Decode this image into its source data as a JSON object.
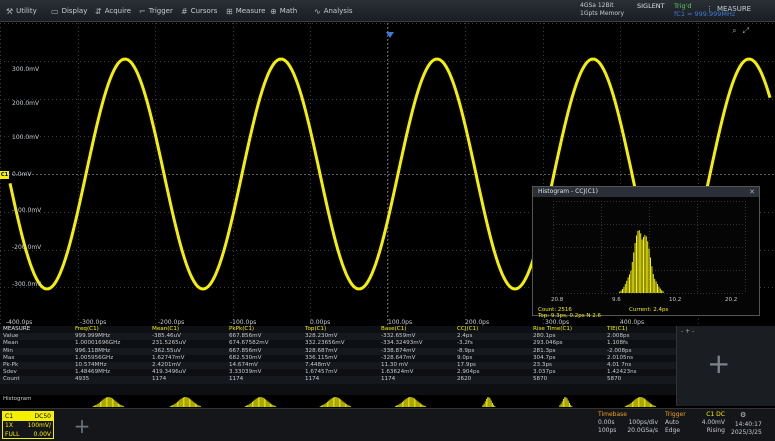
{
  "menu": {
    "items": [
      {
        "label": "Utility",
        "icon": "wrench-icon"
      },
      {
        "label": "Display",
        "icon": "display-icon"
      },
      {
        "label": "Acquire",
        "icon": "acquire-icon"
      },
      {
        "label": "Trigger",
        "icon": "trigger-icon"
      },
      {
        "label": "Cursors",
        "icon": "cursor-icon"
      },
      {
        "label": "Measure",
        "icon": "ruler-icon"
      },
      {
        "label": "Math",
        "icon": "math-icon"
      },
      {
        "label": "Analysis",
        "icon": "analysis-icon"
      }
    ],
    "status_line1": "4GSa 12Bit",
    "status_line2": "1Gpts Memory",
    "brand": "SIGLENT",
    "brand_sub": "Trig'd",
    "trig_freq": "fC1 = 999.999MHz",
    "measure_label": "MEASURE"
  },
  "waveform": {
    "y_labels": [
      "300.0mV",
      "200.0mV",
      "100.0mV",
      "0.0mV",
      "-100.0mV",
      "-200.0mV",
      "-300.0mV"
    ],
    "x_labels": [
      "-400.0ps",
      "-300.0ps",
      "-200.0ps",
      "-100.0ps",
      "0.00ps",
      "100.0ps",
      "200.0ps",
      "300.0ps",
      "400.0ps"
    ],
    "channel_marker": "C1",
    "trace_color": "#f4f000",
    "trigger_color": "#3a7bd5"
  },
  "histogram": {
    "title": "Histogram - CCJ(C1)",
    "x_ticks": [
      "20.8",
      "9.6",
      "10.2",
      "20.2"
    ],
    "count": "Count: 2516",
    "current": "Current: 2.4ps",
    "stats": "Top: 9.3ps, 0.2ps N 2.6"
  },
  "measure": {
    "label": "MEASURE",
    "headers": [
      "Freq(C1)",
      "Mean(C1)",
      "PkPk(C1)",
      "Top(C1)",
      "Base(C1)",
      "CCJ(C1)",
      "Rise Time(C1)",
      "TIE(C1)"
    ],
    "rows": [
      {
        "label": "Value",
        "cells": [
          "999.999MHz",
          "-385.46uV",
          "667.856mV",
          "328.230mV",
          "-332.659mV",
          "2.4ps",
          "280.1ps",
          "2.008ps"
        ]
      },
      {
        "label": "Mean",
        "cells": [
          "1.00001696GHz",
          "231.5265uV",
          "674.67582mV",
          "332.23656mV",
          "-334.32493mV",
          "-3.2fs",
          "293.046ps",
          "1.108fs"
        ]
      },
      {
        "label": "Min",
        "cells": [
          "996.118MHz",
          "-362.55uV",
          "667.856mV",
          "328.687mV",
          "-338.874mV",
          "-8.9ps",
          "281.3ps",
          "-2.008ps"
        ]
      },
      {
        "label": "Max",
        "cells": [
          "1.005956GHz",
          "1.62747mV",
          "682.530mV",
          "336.115mV",
          "-328.647mV",
          "9.0ps",
          "304.7ps",
          "2.0105ns"
        ]
      },
      {
        "label": "Pk-Pk",
        "cells": [
          "10.574MHz",
          "2.4201mV",
          "14.674mV",
          "7.448mV",
          "11.30 mV",
          "17.9ps",
          "23.3ps",
          "4.01 7ns"
        ]
      },
      {
        "label": "Sdev",
        "cells": [
          "1.48469MHz",
          "419.3496uV",
          "3.33039mV",
          "1.67457mV",
          "1.63624mV",
          "2.904ps",
          "3.037ps",
          "1.42423ns"
        ]
      },
      {
        "label": "Count",
        "cells": [
          "4935",
          "1174",
          "1174",
          "1174",
          "1174",
          "2620",
          "5870",
          "5870"
        ]
      }
    ],
    "histogram_label": "Histogram",
    "side_dots": "- + -"
  },
  "bottom": {
    "ch1": {
      "name": "C1",
      "coupling": "DC50",
      "scale": "100mV/",
      "bw": "FULL",
      "offset": "0.00V",
      "probe": "1X"
    },
    "timebase": {
      "header": "Timebase",
      "l1a": "0.00s",
      "l1b": "100ps/div",
      "l2a": "100ps",
      "l2b": "20.0GSa/s"
    },
    "trigger": {
      "header": "Trigger",
      "l1a": "Auto",
      "l1b": "4.00mV",
      "l2a": "Edge",
      "l2b": "Rising",
      "source": "C1 DC"
    },
    "time": "14:40:17",
    "date": "2025/3/25"
  }
}
